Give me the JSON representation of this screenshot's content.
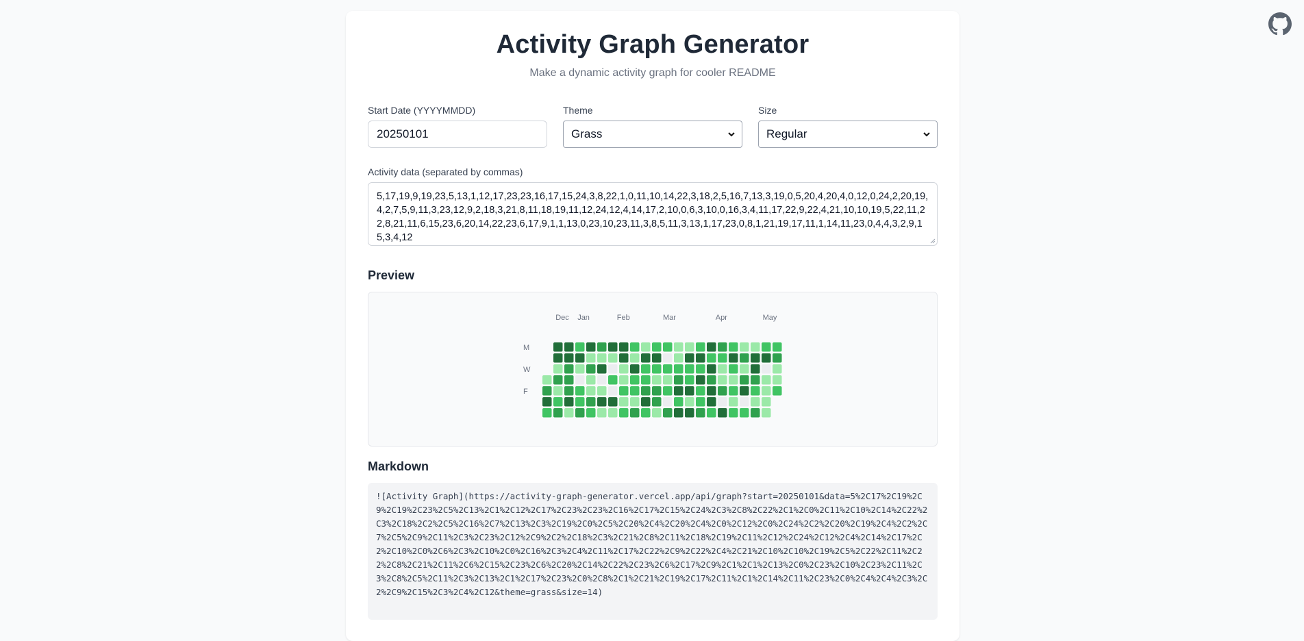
{
  "header": {
    "title": "Activity Graph Generator",
    "subtitle": "Make a dynamic activity graph for cooler README"
  },
  "icons": {
    "github": "github-icon"
  },
  "form": {
    "start_date_label": "Start Date (YYYYMMDD)",
    "start_date_value": "20250101",
    "theme_label": "Theme",
    "theme_value": "Grass",
    "size_label": "Size",
    "size_value": "Regular",
    "activity_label": "Activity data (separated by commas)",
    "activity_value": "5,17,19,9,19,23,5,13,1,12,17,23,23,16,17,15,24,3,8,22,1,0,11,10,14,22,3,18,2,5,16,7,13,3,19,0,5,20,4,20,4,0,12,0,24,2,20,19,4,2,7,5,9,11,3,23,12,9,2,18,3,21,8,11,18,19,11,12,24,12,4,14,17,2,10,0,6,3,10,0,16,3,4,11,17,22,9,22,4,21,10,10,19,5,22,11,22,8,21,11,6,15,23,6,20,14,22,23,6,17,9,1,1,13,0,23,10,23,11,3,8,5,11,3,13,1,17,23,0,8,1,21,19,17,11,1,14,11,23,0,4,4,3,2,9,15,3,4,12"
  },
  "preview": {
    "heading": "Preview",
    "months": [
      "Dec",
      "Jan",
      "Feb",
      "Mar",
      "Apr",
      "May"
    ],
    "day_labels": [
      "M",
      "W",
      "F"
    ],
    "palette": [
      "#ebedf0",
      "#9be9a8",
      "#40c463",
      "#30a14e",
      "#216e39"
    ]
  },
  "markdown": {
    "heading": "Markdown",
    "code": "![Activity Graph](https://activity-graph-generator.vercel.app/api/graph?start=20250101&data=5%2C17%2C19%2C9%2C19%2C23%2C5%2C13%2C1%2C12%2C17%2C23%2C23%2C16%2C17%2C15%2C24%2C3%2C8%2C22%2C1%2C0%2C11%2C10%2C14%2C22%2C3%2C18%2C2%2C5%2C16%2C7%2C13%2C3%2C19%2C0%2C5%2C20%2C4%2C20%2C4%2C0%2C12%2C0%2C24%2C2%2C20%2C19%2C4%2C2%2C7%2C5%2C9%2C11%2C3%2C23%2C12%2C9%2C2%2C18%2C3%2C21%2C8%2C11%2C18%2C19%2C11%2C12%2C24%2C12%2C4%2C14%2C17%2C2%2C10%2C0%2C6%2C3%2C10%2C0%2C16%2C3%2C4%2C11%2C17%2C22%2C9%2C22%2C4%2C21%2C10%2C10%2C19%2C5%2C22%2C11%2C22%2C8%2C21%2C11%2C6%2C15%2C23%2C6%2C20%2C14%2C22%2C23%2C6%2C17%2C9%2C1%2C1%2C13%2C0%2C23%2C10%2C23%2C11%2C3%2C8%2C5%2C11%2C3%2C13%2C1%2C17%2C23%2C0%2C8%2C1%2C21%2C19%2C17%2C11%2C1%2C14%2C11%2C23%2C0%2C4%2C4%2C3%2C2%2C9%2C15%2C3%2C4%2C12&theme=grass&size=14)"
  }
}
